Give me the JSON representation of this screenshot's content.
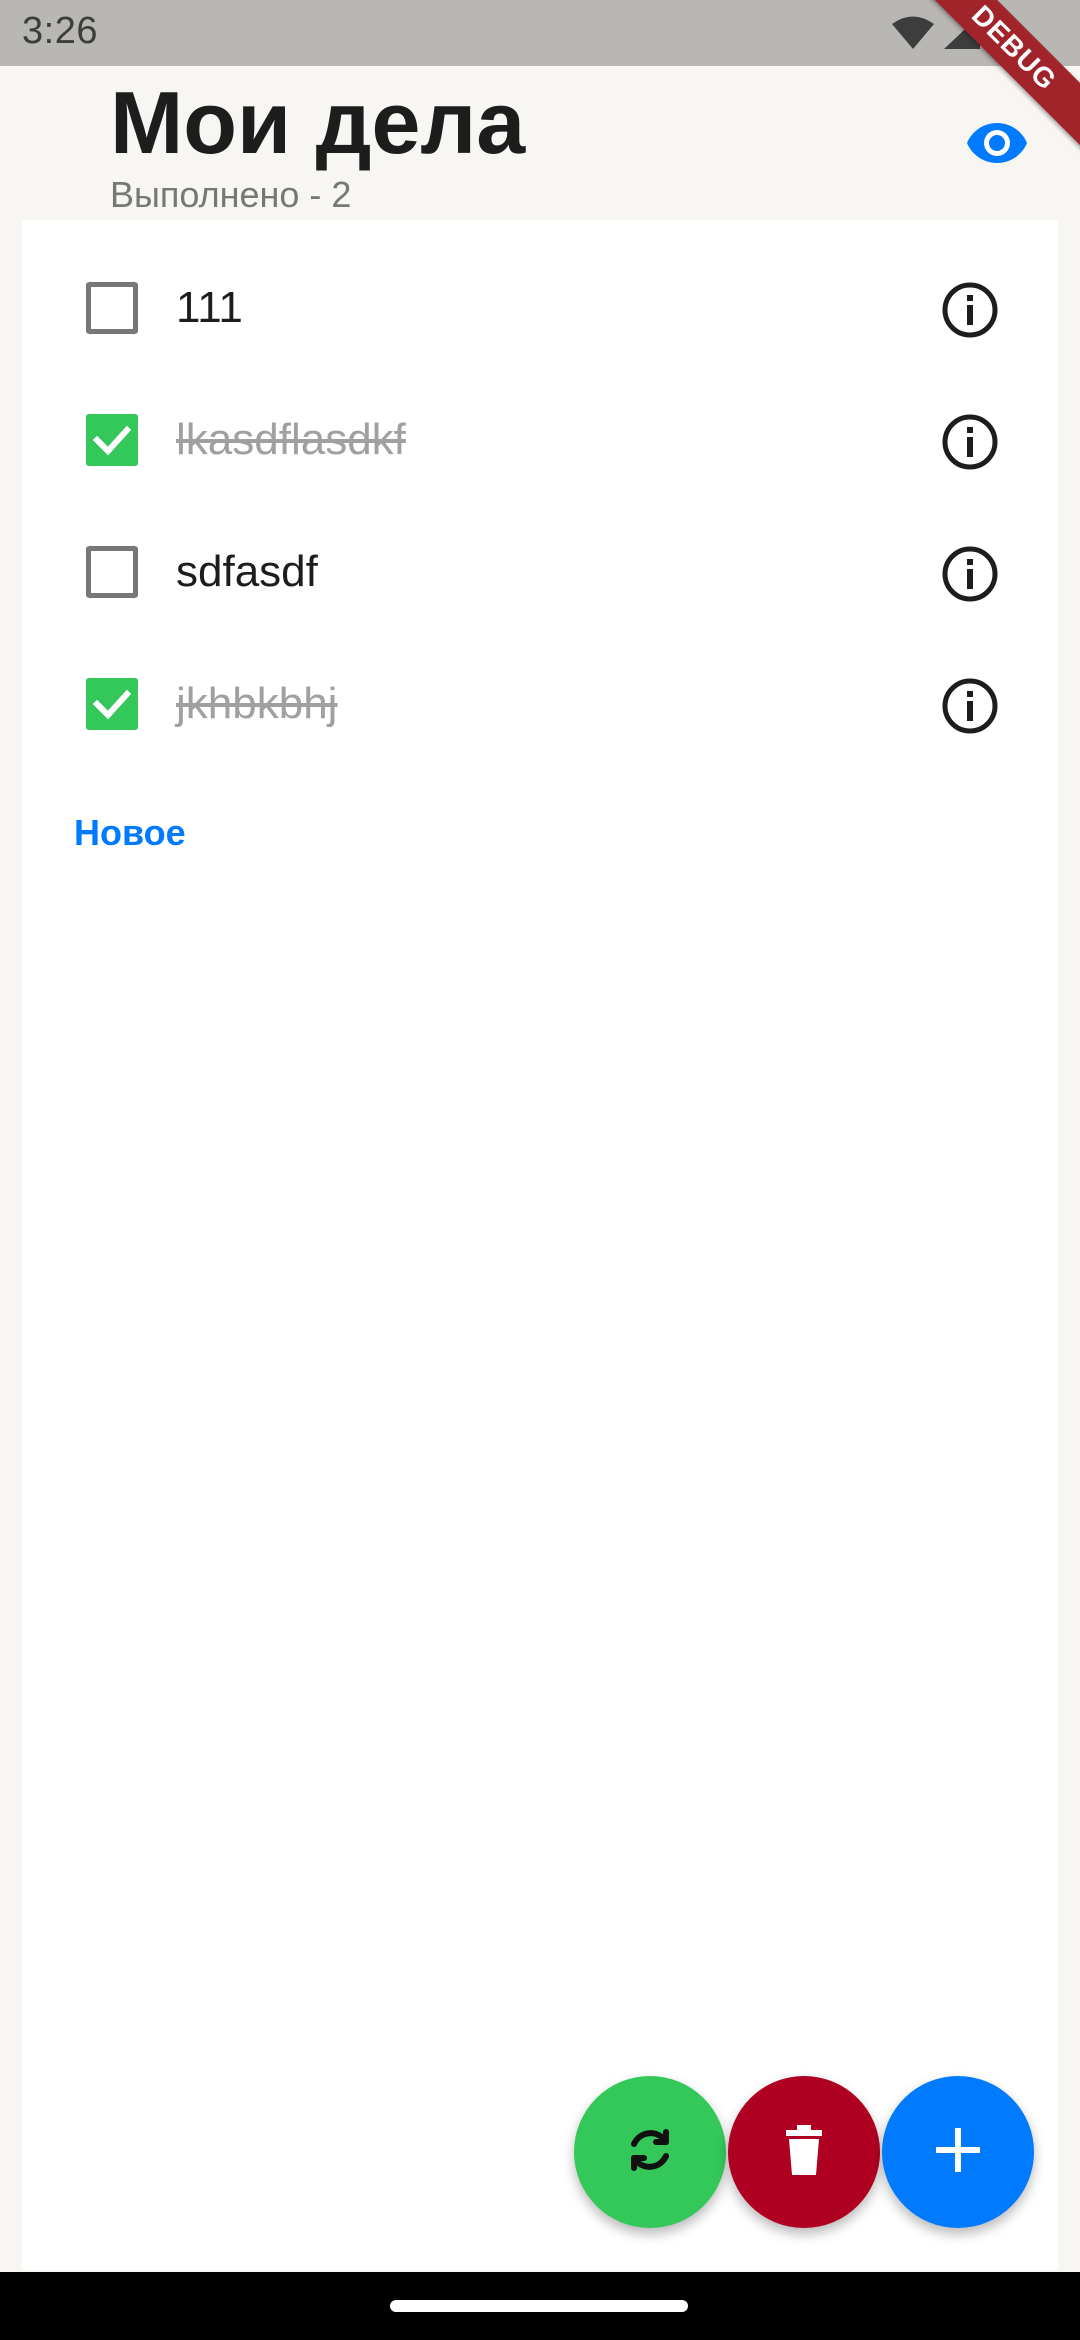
{
  "status_bar": {
    "time": "3:26",
    "icons": [
      "wifi-icon",
      "signal-icon",
      "battery-icon"
    ],
    "debug_label": "DEBUG"
  },
  "header": {
    "title": "Мои дела",
    "subtitle": "Выполнено - 2",
    "visibility_icon": "eye-icon"
  },
  "tasks": [
    {
      "text": "111",
      "done": false
    },
    {
      "text": "lkasdflasdkf",
      "done": true
    },
    {
      "text": "sdfasdf",
      "done": false
    },
    {
      "text": "jkhbkbhj",
      "done": true
    }
  ],
  "new_link": "Новое",
  "fabs": {
    "refresh_icon": "refresh-icon",
    "delete_icon": "trash-icon",
    "add_icon": "plus-icon"
  },
  "colors": {
    "accent": "#007AFF",
    "success": "#34C759",
    "danger": "#B00022",
    "background": "#F7F6F2"
  }
}
